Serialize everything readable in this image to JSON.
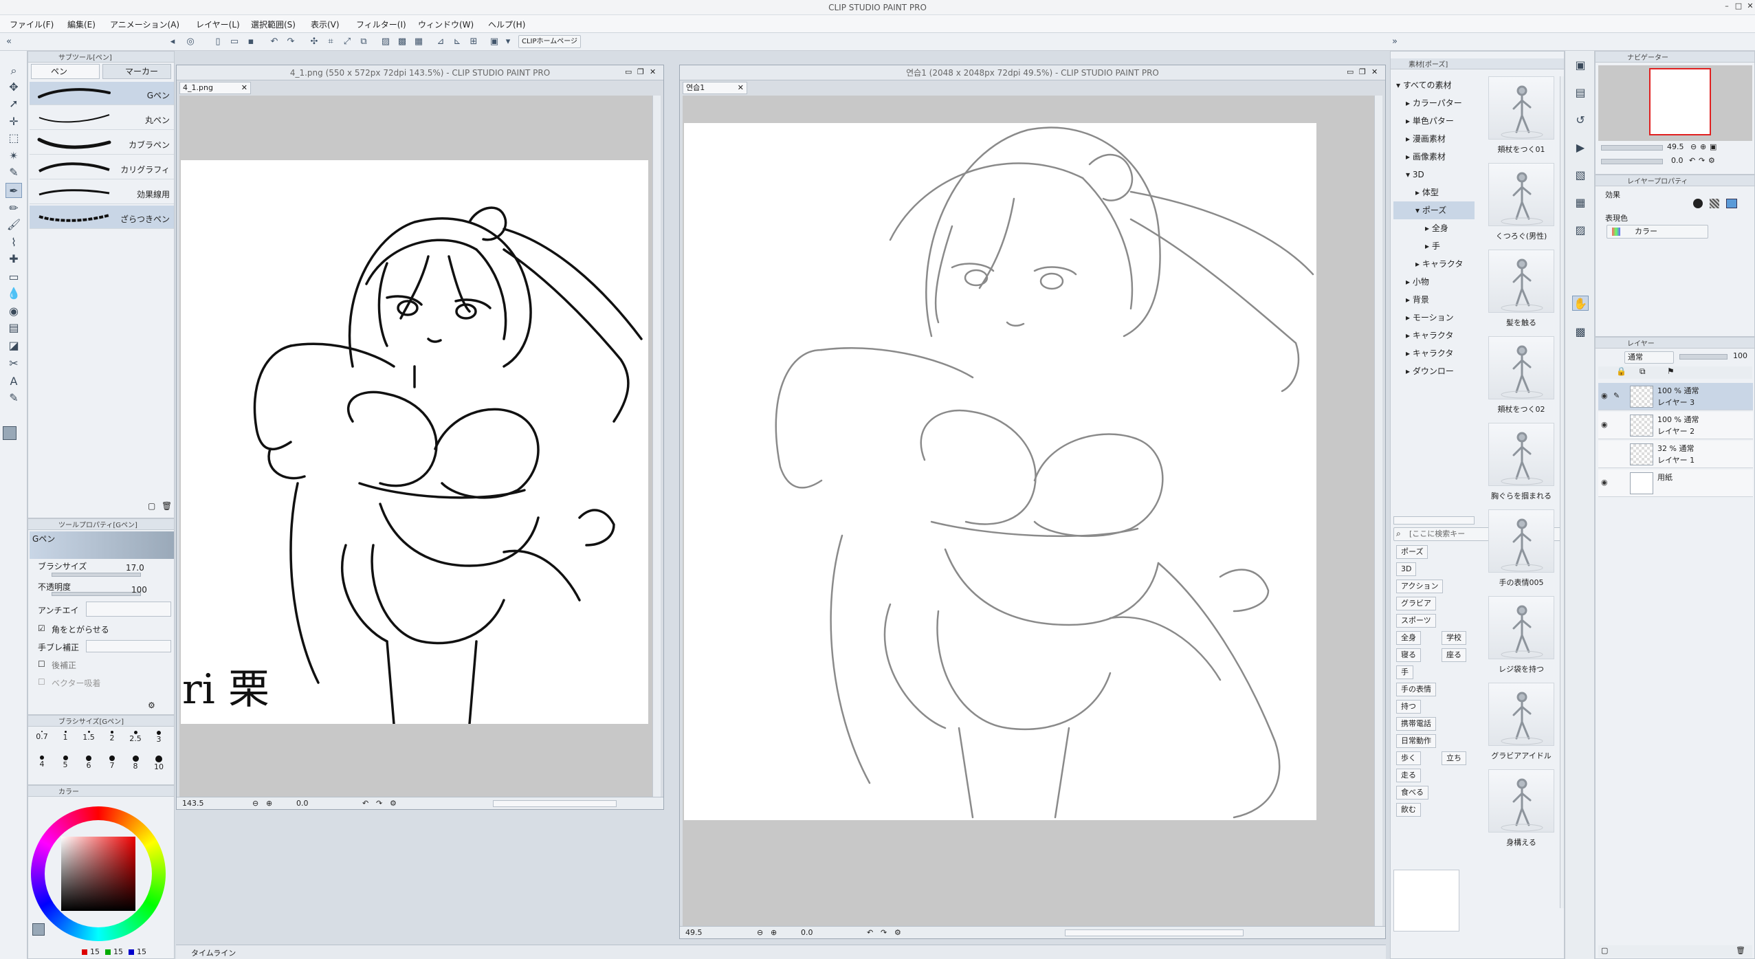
{
  "window": {
    "title": "CLIP STUDIO PAINT PRO",
    "controls": [
      "–",
      "□",
      "✕"
    ]
  },
  "menu": [
    "ファイル(F)",
    "編集(E)",
    "アニメーション(A)",
    "レイヤー(L)",
    "選択範囲(S)",
    "表示(V)",
    "フィルター(I)",
    "ウィンドウ(W)",
    "ヘルプ(H)"
  ],
  "command_bar": {
    "home_button": "CLIPホームページ"
  },
  "subtool": {
    "header": "サブツール[ペン]",
    "tabs": [
      "ペン",
      "マーカー"
    ],
    "brushes": [
      "Gペン",
      "丸ペン",
      "カブラペン",
      "カリグラフィ",
      "効果線用",
      "ざらつきペン"
    ]
  },
  "tool_property": {
    "header": "ツールプロパティ[Gペン]",
    "brush_name": "Gペン",
    "brush_size_label": "ブラシサイズ",
    "brush_size_value": "17.0",
    "opacity_label": "不透明度",
    "opacity_value": "100",
    "antialias_label": "アンチエイ",
    "sharpen_label": "角をとがらせる",
    "stabilization_label": "手ブレ補正",
    "post_correction_label": "後補正",
    "vector_label": "ベクター吸着"
  },
  "brush_size_panel": {
    "header": "ブラシサイズ[Gペン]",
    "sizes": [
      "0.7",
      "1",
      "1.5",
      "2",
      "2.5",
      "3",
      "4",
      "5",
      "6",
      "7",
      "8",
      "10"
    ]
  },
  "color_panel": {
    "header": "カラー",
    "rgb": {
      "r": "15",
      "g": "15",
      "b": "15"
    }
  },
  "timeline": {
    "label": "タイムライン"
  },
  "doc1": {
    "title": "4_1.png (550 x 572px 72dpi 143.5%)  - CLIP STUDIO PAINT PRO",
    "tab": "4_1.png",
    "zoom": "143.5",
    "angle": "0.0",
    "signature": "ri 栗"
  },
  "doc2": {
    "title": "연습1 (2048 x 2048px 72dpi 49.5%)  - CLIP STUDIO PAINT PRO",
    "tab": "연습1",
    "zoom": "49.5",
    "angle": "0.0"
  },
  "material": {
    "header": "素材[ポーズ]",
    "tree": [
      "すべての素材",
      "カラーパター",
      "単色パター",
      "漫画素材",
      "画像素材",
      "3D",
      "体型",
      "ポーズ",
      "全身",
      "手",
      "キャラクタ",
      "小物",
      "背景",
      "モーション",
      "キャラクタ",
      "キャラクタ",
      "ダウンロー"
    ],
    "search_placeholder": "[ここに検索キー",
    "tags": [
      "ポーズ",
      "3D",
      "アクション",
      "グラビア",
      "スポーツ",
      "全身",
      "学校",
      "寝る",
      "座る",
      "手",
      "手の表情",
      "持つ",
      "携帯電話",
      "日常動作",
      "歩く",
      "立ち",
      "走る",
      "食べる",
      "飲む"
    ],
    "thumbnails": [
      "頬杖をつく01",
      "くつろぐ(男性)",
      "髪を触る",
      "頬杖をつく02",
      "胸ぐらを掴まれる",
      "手の表情005",
      "レジ袋を持つ",
      "グラビアアイドル",
      "身構える"
    ]
  },
  "navigator": {
    "header": "ナビゲーター",
    "zoom": "49.5",
    "angle": "0.0"
  },
  "layer_property": {
    "header": "レイヤープロパティ",
    "effect_label": "効果",
    "display_color_label": "表現色",
    "display_color_value": "カラー"
  },
  "layers": {
    "header": "レイヤー",
    "blend_mode": "通常",
    "opacity": "100",
    "items": [
      {
        "opacity": "100 %",
        "mode": "通常",
        "name": "レイヤー 3"
      },
      {
        "opacity": "100 %",
        "mode": "通常",
        "name": "レイヤー 2"
      },
      {
        "opacity": "32 %",
        "mode": "通常",
        "name": "レイヤー 1"
      },
      {
        "opacity": "",
        "mode": "",
        "name": "用紙"
      }
    ]
  }
}
